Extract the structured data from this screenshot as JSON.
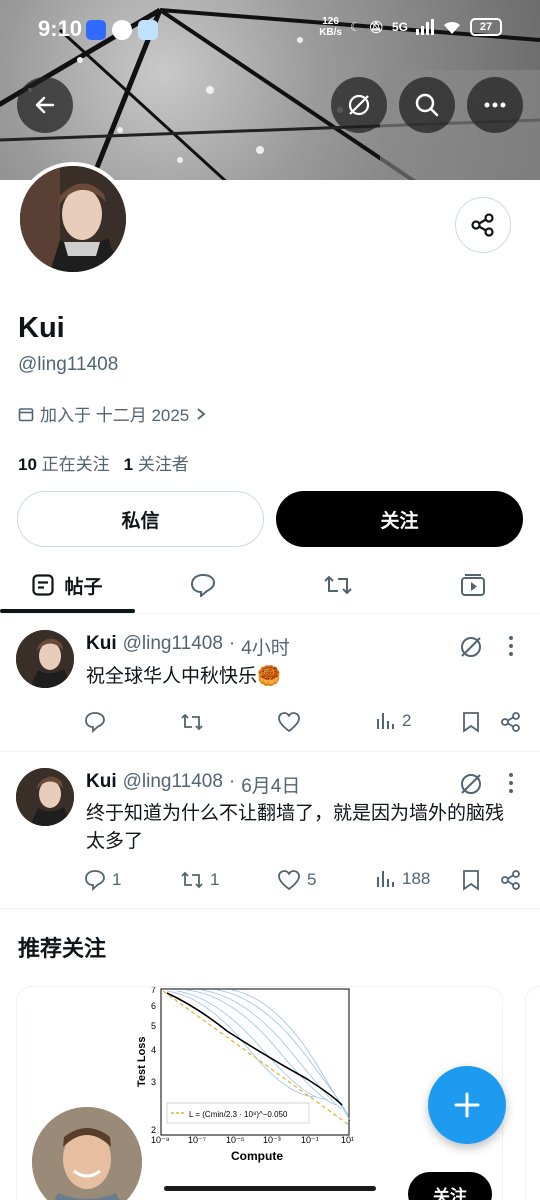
{
  "status": {
    "time": "9:10",
    "net_speed": "126",
    "net_unit": "KB/s",
    "network": "5G",
    "battery": "27"
  },
  "profile": {
    "name": "Kui",
    "handle": "@ling11408",
    "joined": "加入于 十二月 2025",
    "following_count": "10",
    "following_label": "正在关注",
    "followers_count": "1",
    "followers_label": "关注者"
  },
  "buttons": {
    "message": "私信",
    "follow": "关注"
  },
  "tabs": {
    "posts": "帖子"
  },
  "posts": [
    {
      "name": "Kui",
      "handle": "@ling11408",
      "sep": "·",
      "time": "4小时",
      "text": "祝全球华人中秋快乐🥮",
      "replies": "",
      "reposts": "",
      "likes": "",
      "views": "2"
    },
    {
      "name": "Kui",
      "handle": "@ling11408",
      "sep": "·",
      "time": "6月4日",
      "text": "终于知道为什么不让翻墙了，就是因为墙外的脑残太多了",
      "replies": "1",
      "reposts": "1",
      "likes": "5",
      "views": "188"
    }
  ],
  "recommend": {
    "title": "推荐关注",
    "follow_label": "关注",
    "figure": {
      "ylabel": "Test Loss",
      "xlabel": "Compute",
      "yticks": [
        "7",
        "6",
        "5",
        "4",
        "3",
        "2"
      ],
      "xticks": [
        "10⁻⁹",
        "10⁻⁷",
        "10⁻⁵",
        "10⁻³",
        "10⁻¹",
        "10¹"
      ],
      "legend": "L = (Cmin/2.3 · 10⁸)^−0.050"
    }
  },
  "colors": {
    "accent": "#1d9bf0",
    "text": "#0f1419",
    "secondary": "#536471",
    "border": "#cfd9de"
  }
}
